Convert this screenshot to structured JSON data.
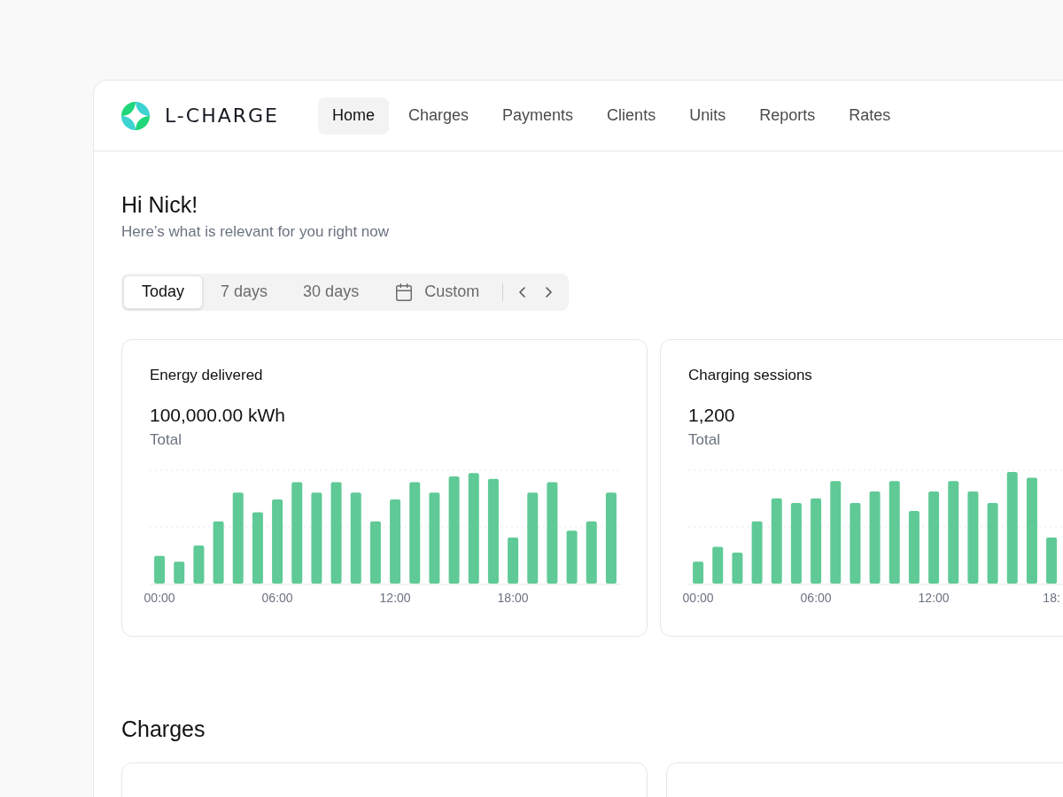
{
  "brand": {
    "name": "L-CHARGE"
  },
  "nav": [
    {
      "label": "Home",
      "selected": true
    },
    {
      "label": "Charges",
      "selected": false
    },
    {
      "label": "Payments",
      "selected": false
    },
    {
      "label": "Clients",
      "selected": false
    },
    {
      "label": "Units",
      "selected": false
    },
    {
      "label": "Reports",
      "selected": false
    },
    {
      "label": "Rates",
      "selected": false
    }
  ],
  "greeting": {
    "title": "Hi Nick!",
    "subtitle": "Here’s what is relevant for you right now"
  },
  "range": [
    {
      "label": "Today",
      "kind": "option",
      "selected": true
    },
    {
      "label": "7 days",
      "kind": "option",
      "selected": false
    },
    {
      "label": "30 days",
      "kind": "option",
      "selected": false
    },
    {
      "label": "Custom",
      "kind": "calendar",
      "selected": false
    }
  ],
  "cards": [
    {
      "title": "Energy delivered",
      "value": "100,000.00 kWh",
      "caption": "Total",
      "x_labels": [
        "00:00",
        "06:00",
        "12:00",
        "18:00"
      ]
    },
    {
      "title": "Charging sessions",
      "value": "1,200",
      "caption": "Total",
      "x_labels": [
        "00:00",
        "06:00",
        "12:00",
        "18:"
      ]
    }
  ],
  "section": {
    "title": "Charges"
  }
}
